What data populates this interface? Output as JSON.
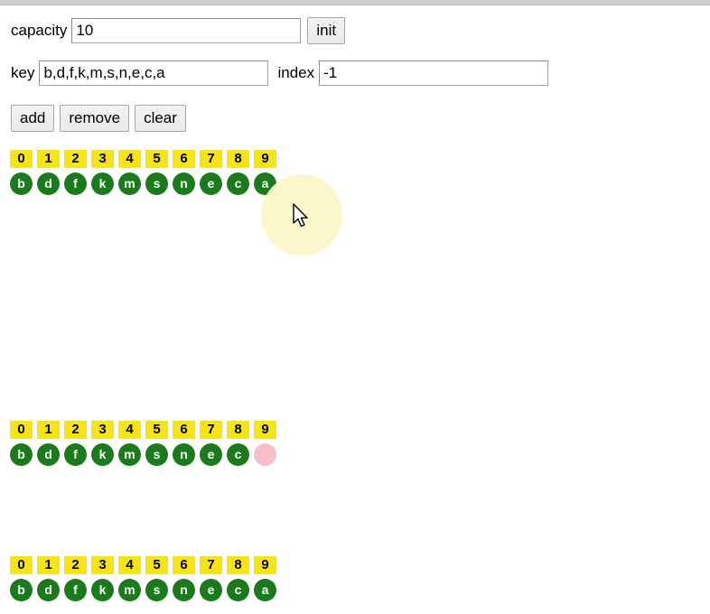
{
  "form": {
    "capacity_label": "capacity",
    "capacity_value": "10",
    "init_label": "init",
    "key_label": "key",
    "key_value": "b,d,f,k,m,s,n,e,c,a",
    "index_label": "index",
    "index_value": "-1",
    "add_label": "add",
    "remove_label": "remove",
    "clear_label": "clear"
  },
  "colors": {
    "index_cell": "#f7e415",
    "value_filled": "#1b7a1b",
    "value_empty": "#f8bfc8",
    "click_highlight": "#fbf6c6"
  },
  "arrays": [
    {
      "name": "array-state-current",
      "indices": [
        "0",
        "1",
        "2",
        "3",
        "4",
        "5",
        "6",
        "7",
        "8",
        "9"
      ],
      "values": [
        "b",
        "d",
        "f",
        "k",
        "m",
        "s",
        "n",
        "e",
        "c",
        "a"
      ],
      "empty_slots": []
    },
    {
      "name": "array-state-before-add",
      "indices": [
        "0",
        "1",
        "2",
        "3",
        "4",
        "5",
        "6",
        "7",
        "8",
        "9"
      ],
      "values": [
        "b",
        "d",
        "f",
        "k",
        "m",
        "s",
        "n",
        "e",
        "c",
        ""
      ],
      "empty_slots": [
        9
      ]
    },
    {
      "name": "array-state-after-add",
      "indices": [
        "0",
        "1",
        "2",
        "3",
        "4",
        "5",
        "6",
        "7",
        "8",
        "9"
      ],
      "values": [
        "b",
        "d",
        "f",
        "k",
        "m",
        "s",
        "n",
        "e",
        "c",
        "a"
      ],
      "empty_slots": []
    }
  ]
}
